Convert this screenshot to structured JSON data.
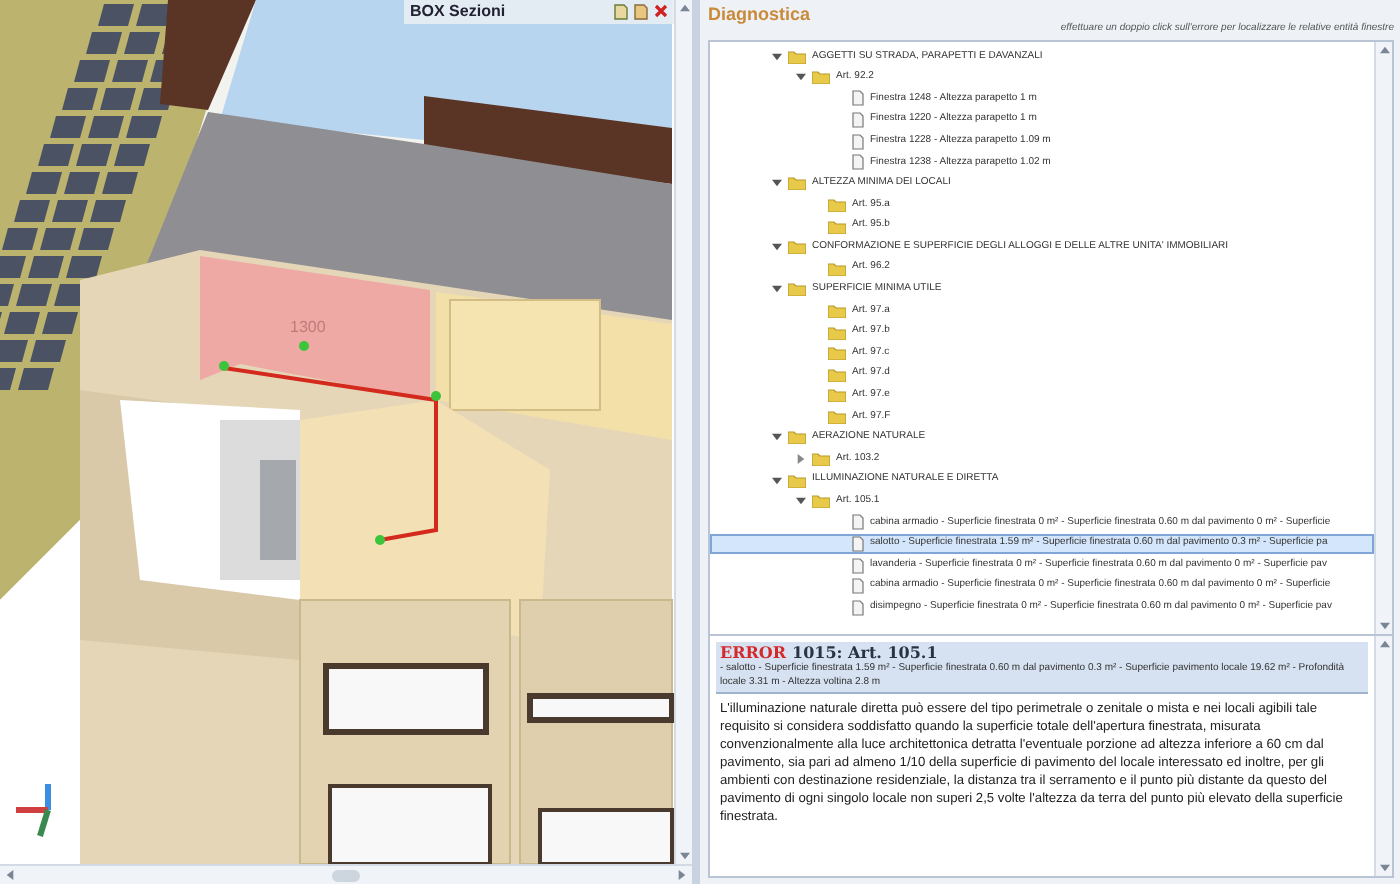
{
  "viewport": {
    "panel_title": "BOX Sezioni",
    "dimension_label": "1300"
  },
  "diagnostics": {
    "title": "Diagnostica",
    "hint": "effettuare un doppio click sull'errore per localizzare le relative entità finestre",
    "tree": [
      {
        "label": "AGGETTI SU STRADA, PARAPETTI E DAVANZALI",
        "kind": "folder",
        "expanded": true,
        "selected": false,
        "children": [
          {
            "label": "Art. 92.2",
            "kind": "folder",
            "expanded": true,
            "selected": false,
            "children": [
              {
                "label": "Finestra 1248 - Altezza parapetto 1 m",
                "kind": "item",
                "selected": false
              },
              {
                "label": "Finestra 1220 - Altezza parapetto 1 m",
                "kind": "item",
                "selected": false
              },
              {
                "label": "Finestra 1228 - Altezza parapetto 1.09 m",
                "kind": "item",
                "selected": false
              },
              {
                "label": "Finestra 1238 - Altezza parapetto 1.02 m",
                "kind": "item",
                "selected": false
              }
            ]
          }
        ]
      },
      {
        "label": "ALTEZZA MINIMA DEI LOCALI",
        "kind": "folder",
        "expanded": true,
        "selected": false,
        "children": [
          {
            "label": "Art. 95.a",
            "kind": "folder",
            "selected": false
          },
          {
            "label": "Art. 95.b",
            "kind": "folder",
            "selected": false
          }
        ]
      },
      {
        "label": "CONFORMAZIONE E SUPERFICIE DEGLI ALLOGGI E DELLE ALTRE UNITA' IMMOBILIARI",
        "kind": "folder",
        "expanded": true,
        "selected": false,
        "children": [
          {
            "label": "Art. 96.2",
            "kind": "folder",
            "selected": false
          }
        ]
      },
      {
        "label": "SUPERFICIE MINIMA UTILE",
        "kind": "folder",
        "expanded": true,
        "selected": false,
        "children": [
          {
            "label": "Art. 97.a",
            "kind": "folder",
            "selected": false
          },
          {
            "label": "Art. 97.b",
            "kind": "folder",
            "selected": false
          },
          {
            "label": "Art. 97.c",
            "kind": "folder",
            "selected": false
          },
          {
            "label": "Art. 97.d",
            "kind": "folder",
            "selected": false
          },
          {
            "label": "Art. 97.e",
            "kind": "folder",
            "selected": false
          },
          {
            "label": "Art. 97.F",
            "kind": "folder",
            "selected": false
          }
        ]
      },
      {
        "label": "AERAZIONE NATURALE",
        "kind": "folder",
        "expanded": true,
        "selected": false,
        "children": [
          {
            "label": "Art. 103.2",
            "kind": "folder",
            "expanded": false,
            "selected": false
          }
        ]
      },
      {
        "label": "ILLUMINAZIONE NATURALE E DIRETTA",
        "kind": "folder",
        "expanded": true,
        "selected": false,
        "children": [
          {
            "label": "Art. 105.1",
            "kind": "folder",
            "expanded": true,
            "selected": false,
            "children": [
              {
                "label": "cabina armadio - Superficie finestrata 0 m² - Superficie finestrata 0.60 m dal pavimento 0 m² - Superficie",
                "kind": "item",
                "selected": false
              },
              {
                "label": "salotto - Superficie finestrata 1.59 m² - Superficie finestrata 0.60 m dal pavimento 0.3 m² - Superficie pa",
                "kind": "item",
                "selected": true
              },
              {
                "label": "lavanderia - Superficie finestrata 0 m² - Superficie finestrata 0.60 m dal pavimento 0 m² - Superficie pav",
                "kind": "item",
                "selected": false
              },
              {
                "label": "cabina armadio - Superficie finestrata 0 m² - Superficie finestrata 0.60 m dal pavimento 0 m² - Superficie",
                "kind": "item",
                "selected": false
              },
              {
                "label": "disimpegno - Superficie finestrata 0 m² - Superficie finestrata 0.60 m dal pavimento 0 m² - Superficie pav",
                "kind": "item",
                "selected": false
              }
            ]
          }
        ]
      }
    ],
    "error": {
      "label": "ERROR",
      "code": "1015: Art. 105.1",
      "detail": "- salotto - Superficie finestrata 1.59 m² - Superficie finestrata 0.60 m dal pavimento 0.3 m² - Superficie pavimento locale 19.62 m² - Profondità locale 3.31 m - Altezza voltina 2.8 m"
    },
    "description": "L'illuminazione naturale diretta può essere del tipo perimetrale o zenitale o mista e nei locali agibili tale requisito si considera soddisfatto quando la superficie totale dell'apertura finestrata, misurata convenzionalmente alla luce architettonica detratta l'eventuale porzione ad altezza inferiore a 60 cm dal pavimento, sia pari ad almeno 1/10 della superficie di pavimento del locale interessato ed inoltre, per gli ambienti con destinazione residenziale, la distanza tra il serramento e il punto più distante da questo del pavimento di ogni singolo locale non superi 2,5 volte l'altezza da terra del punto più elevato della superficie finestrata."
  }
}
